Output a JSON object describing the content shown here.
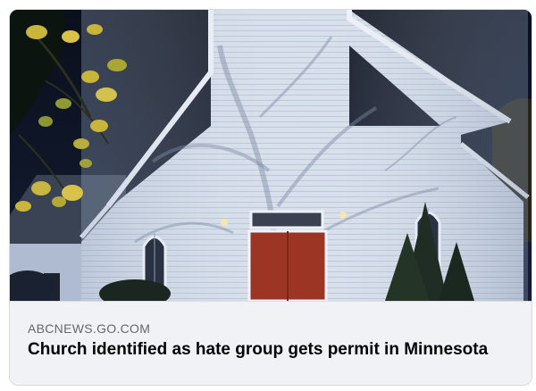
{
  "link_preview": {
    "domain": "ABCNEWS.GO.COM",
    "headline": "Church identified as hate group gets permit in Minnesota",
    "image": {
      "subject": "church-photo",
      "colors": {
        "sky": "#0b1120",
        "siding": "#cfd8e6",
        "door": "#9c3524",
        "foliage": "#c9b53a"
      }
    }
  }
}
